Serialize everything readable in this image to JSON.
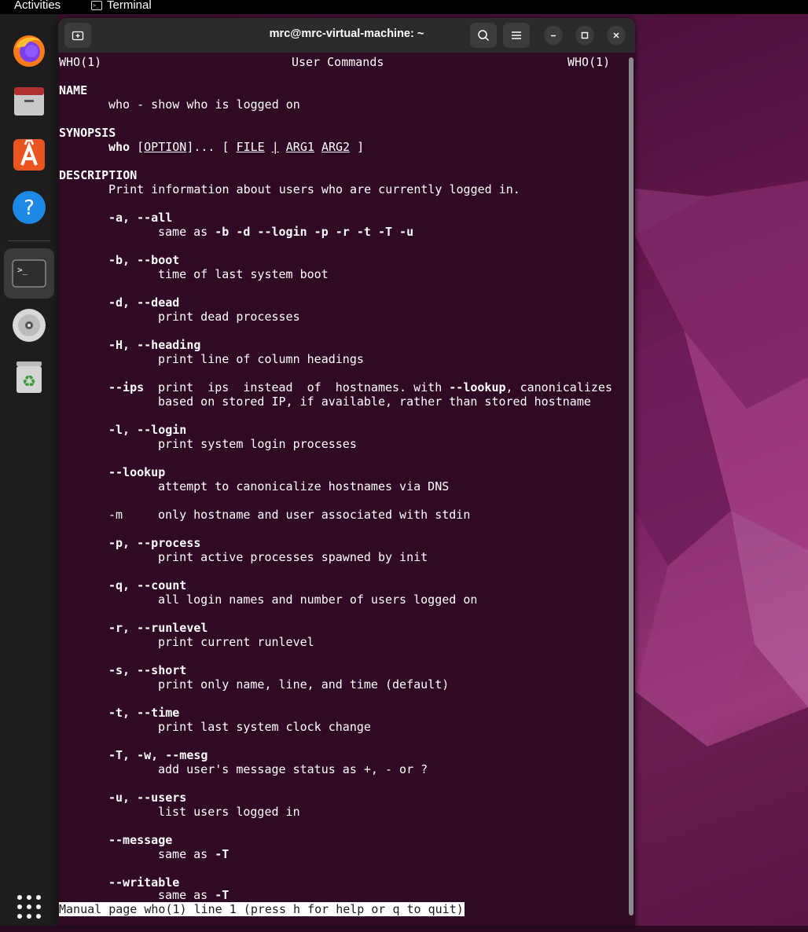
{
  "topbar": {
    "activities_label": "Activities",
    "app_label": "Terminal",
    "app_icon": "terminal-icon"
  },
  "dock": {
    "items": [
      {
        "name": "Firefox",
        "icon": "firefox-icon"
      },
      {
        "name": "Files",
        "icon": "files-icon"
      },
      {
        "name": "Ubuntu Software",
        "icon": "software-store-icon"
      },
      {
        "name": "Help",
        "icon": "help-icon",
        "glyph": "?"
      },
      {
        "name": "Terminal",
        "icon": "terminal-icon",
        "glyph": ">_",
        "active": true
      },
      {
        "name": "Disc",
        "icon": "disc-icon"
      },
      {
        "name": "Trash",
        "icon": "trash-icon",
        "glyph": "♻"
      },
      {
        "name": "Show Applications",
        "icon": "app-grid-icon"
      }
    ]
  },
  "window": {
    "title": "mrc@mrc-virtual-machine: ~",
    "new_tab_icon": "new-tab-icon",
    "search_icon": "search-icon",
    "menu_icon": "hamburger-menu-icon",
    "minimize_icon": "minimize-icon",
    "maximize_icon": "maximize-icon",
    "close_icon": "close-icon"
  },
  "man": {
    "header_left": "WHO(1)",
    "header_center": "User Commands",
    "header_right": "WHO(1)",
    "name_heading": "NAME",
    "name_text": "who - show who is logged on",
    "synopsis_heading": "SYNOPSIS",
    "synopsis": {
      "cmd": "who",
      "open": "[",
      "option": "OPTION",
      "mid": "]... [",
      "file": "FILE",
      "pipe": "|",
      "arg1": "ARG1",
      "arg2": "ARG2",
      "close": "]"
    },
    "description_heading": "DESCRIPTION",
    "description_text": "Print information about users who are currently logged in.",
    "options": [
      {
        "flag": "-a, --all",
        "desc_prefix": "same as ",
        "desc_bold": "-b -d --login -p -r -t -T -u"
      },
      {
        "flag": "-b, --boot",
        "desc": "time of last system boot"
      },
      {
        "flag": "-d, --dead",
        "desc": "print dead processes"
      },
      {
        "flag": "-H, --heading",
        "desc": "print line of column headings"
      },
      {
        "flag": "--ips",
        "desc_1a": "print  ips  instead  of  hostnames. with ",
        "desc_1b": "--lookup",
        "desc_1c": ", canonicalizes",
        "desc_2": "based on stored IP, if available, rather than stored hostname"
      },
      {
        "flag": "-l, --login",
        "desc": "print system login processes"
      },
      {
        "flag": "--lookup",
        "desc": "attempt to canonicalize hostnames via DNS"
      },
      {
        "flag": "-m",
        "desc": "only hostname and user associated with stdin"
      },
      {
        "flag": "-p, --process",
        "desc": "print active processes spawned by init"
      },
      {
        "flag": "-q, --count",
        "desc": "all login names and number of users logged on"
      },
      {
        "flag": "-r, --runlevel",
        "desc": "print current runlevel"
      },
      {
        "flag": "-s, --short",
        "desc": "print only name, line, and time (default)"
      },
      {
        "flag": "-t, --time",
        "desc": "print last system clock change"
      },
      {
        "flag": "-T, -w, --mesg",
        "desc": "add user's message status as +, - or ?"
      },
      {
        "flag": "-u, --users",
        "desc": "list users logged in"
      },
      {
        "flag": "--message",
        "desc_prefix": "same as ",
        "desc_bold": "-T"
      },
      {
        "flag": "--writable",
        "desc_prefix": "same as ",
        "desc_bold": "-T"
      }
    ],
    "status_line": "Manual page who(1) line 1 (press h for help or q to quit)"
  },
  "colors": {
    "terminal_bg": "#300a24",
    "titlebar_bg": "#2b2b2b",
    "accent": "#e95420"
  }
}
